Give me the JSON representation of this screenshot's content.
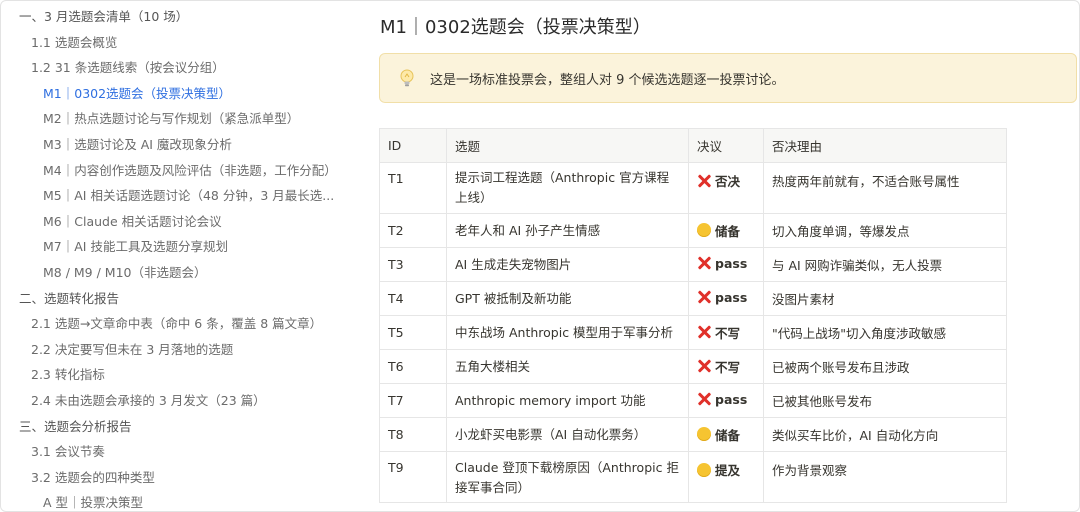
{
  "toc": {
    "items": [
      {
        "level": 1,
        "label": "一、3 月选题会清单（10 场）",
        "active": false
      },
      {
        "level": 2,
        "label": "1.1 选题会概览",
        "active": false
      },
      {
        "level": 2,
        "label": "1.2 31 条选题线索（按会议分组）",
        "active": false
      },
      {
        "level": 3,
        "label": "M1｜0302选题会（投票决策型）",
        "active": true
      },
      {
        "level": 3,
        "label": "M2｜热点选题讨论与写作规划（紧急派单型）",
        "active": false
      },
      {
        "level": 3,
        "label": "M3｜选题讨论及 AI 魔改现象分析",
        "active": false
      },
      {
        "level": 3,
        "label": "M4｜内容创作选题及风险评估（非选题，工作分配）",
        "active": false
      },
      {
        "level": 3,
        "label": "M5｜AI 相关话题选题讨论（48 分钟，3 月最长选...",
        "active": false
      },
      {
        "level": 3,
        "label": "M6｜Claude 相关话题讨论会议",
        "active": false
      },
      {
        "level": 3,
        "label": "M7｜AI 技能工具及选题分享规划",
        "active": false
      },
      {
        "level": 3,
        "label": "M8 / M9 / M10（非选题会）",
        "active": false
      },
      {
        "level": 1,
        "label": "二、选题转化报告",
        "active": false
      },
      {
        "level": 2,
        "label": "2.1 选题→文章命中表（命中 6 条，覆盖 8 篇文章）",
        "active": false
      },
      {
        "level": 2,
        "label": "2.2 决定要写但未在 3 月落地的选题",
        "active": false
      },
      {
        "level": 2,
        "label": "2.3 转化指标",
        "active": false
      },
      {
        "level": 2,
        "label": "2.4 未由选题会承接的 3 月发文（23 篇）",
        "active": false
      },
      {
        "level": 1,
        "label": "三、选题会分析报告",
        "active": false
      },
      {
        "level": 2,
        "label": "3.1 会议节奏",
        "active": false
      },
      {
        "level": 2,
        "label": "3.2 选题会的四种类型",
        "active": false
      },
      {
        "level": 3,
        "label": "A 型｜投票决策型",
        "active": false
      }
    ]
  },
  "main": {
    "title": "M1｜0302选题会（投票决策型）",
    "callout": {
      "icon": "lightbulb-icon",
      "text": "这是一场标准投票会，整组人对 9 个候选选题逐一投票讨论。"
    },
    "table": {
      "headers": {
        "id": "ID",
        "topic": "选题",
        "decision": "决议",
        "reason": "否决理由"
      },
      "rows": [
        {
          "id": "T1",
          "topic": "提示词工程选题（Anthropic 官方课程上线）",
          "decision": "否决",
          "mark": "x",
          "reason": "热度两年前就有，不适合账号属性",
          "size": "tall"
        },
        {
          "id": "T2",
          "topic": "老年人和 AI 孙子产生情感",
          "decision": "储备",
          "mark": "dot",
          "reason": "切入角度单调，等爆发点",
          "size": "short"
        },
        {
          "id": "T3",
          "topic": "AI 生成走失宠物图片",
          "decision": "pass",
          "mark": "x",
          "reason": "与 AI 网购诈骗类似，无人投票",
          "size": "short"
        },
        {
          "id": "T4",
          "topic": "GPT 被抵制及新功能",
          "decision": "pass",
          "mark": "x",
          "reason": "没图片素材",
          "size": "short"
        },
        {
          "id": "T5",
          "topic": "中东战场 Anthropic 模型用于军事分析",
          "decision": "不写",
          "mark": "x",
          "reason": "\"代码上战场\"切入角度涉政敏感",
          "size": "short"
        },
        {
          "id": "T6",
          "topic": "五角大楼相关",
          "decision": "不写",
          "mark": "x",
          "reason": "已被两个账号发布且涉政",
          "size": "short"
        },
        {
          "id": "T7",
          "topic": "Anthropic memory import 功能",
          "decision": "pass",
          "mark": "x",
          "reason": "已被其他账号发布",
          "size": "short"
        },
        {
          "id": "T8",
          "topic": "小龙虾买电影票（AI 自动化票务）",
          "decision": "储备",
          "mark": "dot",
          "reason": "类似买车比价，AI 自动化方向",
          "size": "short"
        },
        {
          "id": "T9",
          "topic": "Claude 登顶下载榜原因（Anthropic 拒接军事合同）",
          "decision": "提及",
          "mark": "dot",
          "reason": "作为背景观察",
          "size": "cut"
        }
      ]
    }
  },
  "colors": {
    "accent": "#2f6fe0",
    "callout_bg": "#fbf3db",
    "x_mark": "#e0302a",
    "dot_mark": "#f6c431"
  }
}
